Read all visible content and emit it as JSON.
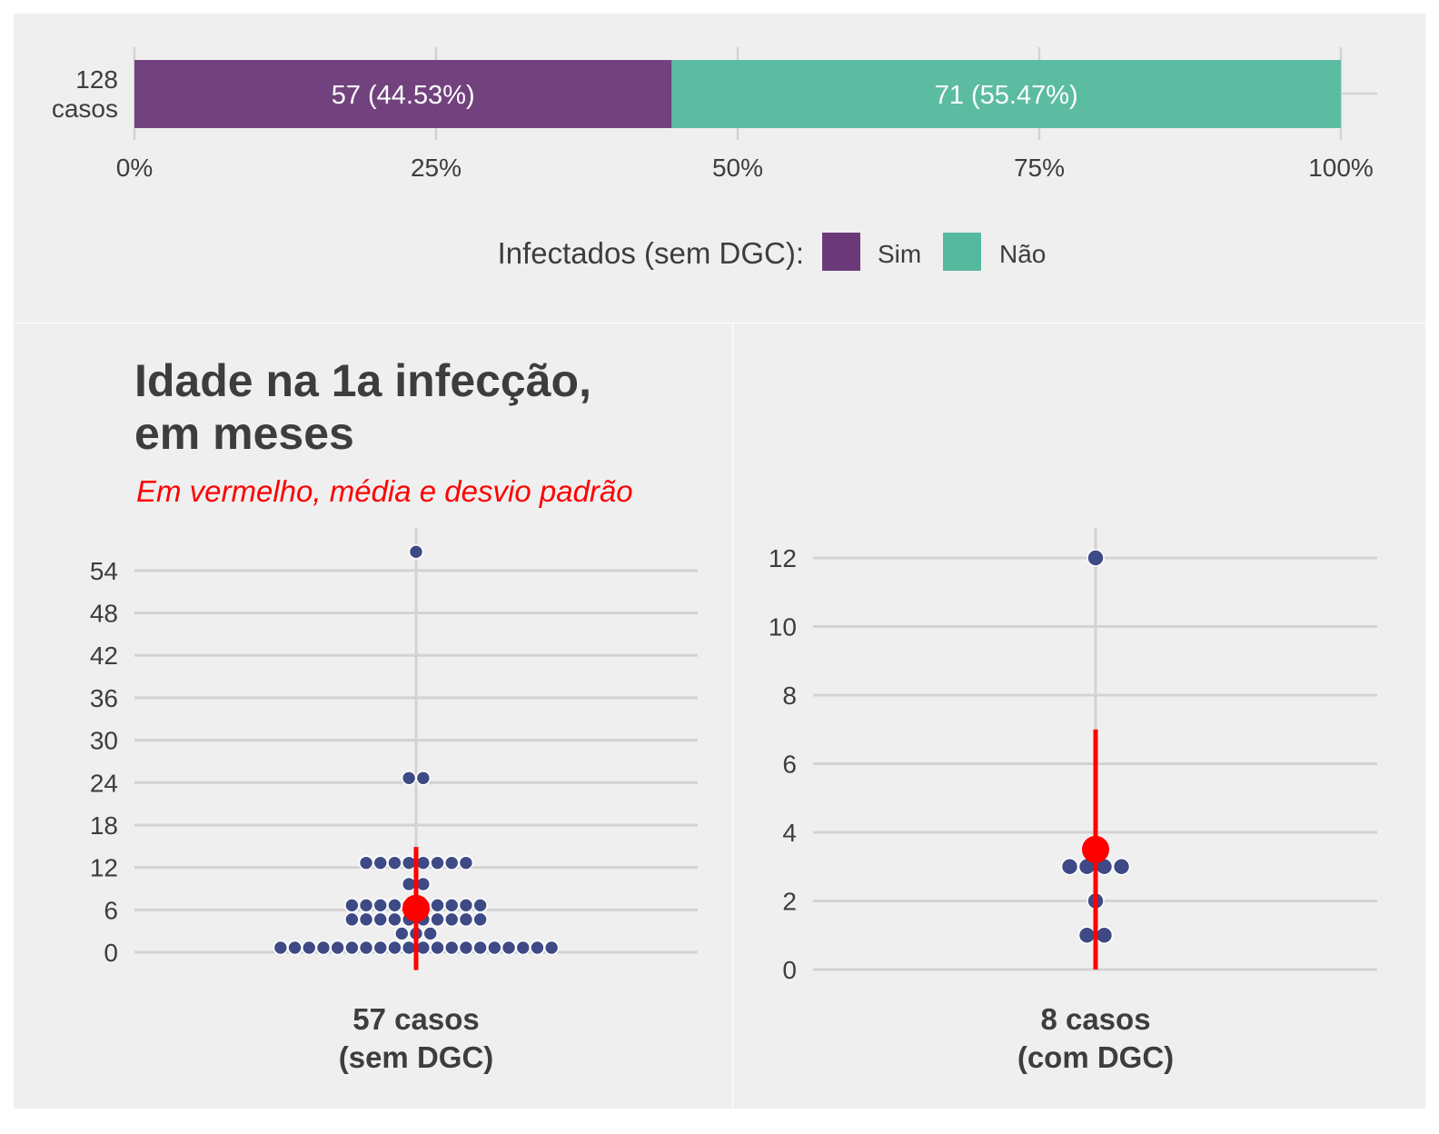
{
  "colors": {
    "panel_bg": "#efefef",
    "grid": "#d3d3d3",
    "text": "#3d3d3d",
    "sim": "#6c3a79",
    "nao": "#55b99e",
    "dot": "#3e4a86",
    "stat": "#ff0000"
  },
  "chart_data": [
    {
      "type": "bar",
      "orientation": "horizontal",
      "stacked": true,
      "category_label": "128\ncasos",
      "series": [
        {
          "name": "Sim",
          "value": 57,
          "label": "57 (44.53%)"
        },
        {
          "name": "Não",
          "value": 71,
          "label": "71 (55.47%)"
        }
      ],
      "xlim": [
        0,
        1
      ],
      "xticks": [
        0,
        0.25,
        0.5,
        0.75,
        1
      ],
      "xtick_labels": [
        "0%",
        "25%",
        "50%",
        "75%",
        "100%"
      ],
      "legend": {
        "title": "Infectados (sem DGC):",
        "position": "bottom",
        "entries": [
          "Sim",
          "Não"
        ]
      },
      "grid": true
    },
    {
      "type": "scatter",
      "style": "dotplot",
      "title": "Idade na 1a infecção,\nem meses",
      "subtitle": "Em vermelho, média e desvio padrão",
      "xlabel": "57 casos\n(sem DGC)",
      "yticks": [
        0,
        6,
        12,
        18,
        24,
        30,
        36,
        42,
        48,
        54
      ],
      "ylim": [
        -2.5,
        58.5
      ],
      "values": [
        0,
        0,
        0,
        0,
        0,
        0,
        0,
        0,
        0,
        0,
        0,
        0,
        0,
        0,
        0,
        0,
        0,
        0,
        0,
        0,
        2,
        2,
        2,
        4,
        4,
        4,
        4,
        4,
        4,
        4,
        4,
        4,
        4,
        6,
        6,
        6,
        6,
        6,
        6,
        6,
        6,
        6,
        6,
        9,
        9,
        12,
        12,
        12,
        12,
        12,
        12,
        12,
        12,
        24,
        24,
        56
      ],
      "mean": 6.2,
      "sd_range": [
        -2.5,
        14.9
      ],
      "grid": true
    },
    {
      "type": "scatter",
      "style": "dotplot",
      "xlabel": "8 casos\n(com DGC)",
      "yticks": [
        0,
        2,
        4,
        6,
        8,
        10,
        12
      ],
      "ylim": [
        0,
        12.8
      ],
      "values": [
        1,
        1,
        2,
        3,
        3,
        3,
        3,
        12
      ],
      "mean": 3.5,
      "sd_range": [
        0,
        7.0
      ],
      "grid": true
    }
  ]
}
